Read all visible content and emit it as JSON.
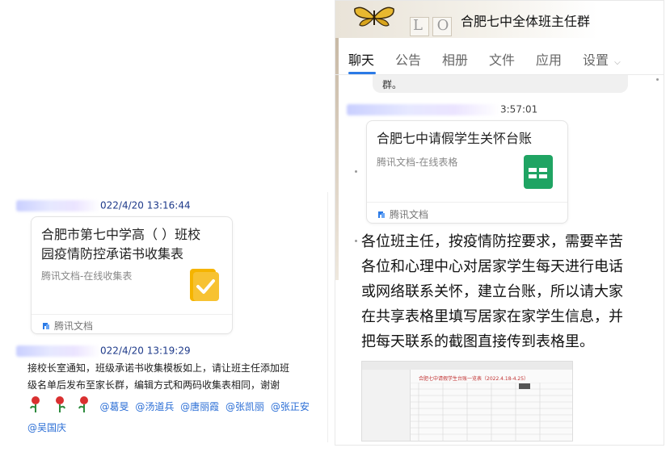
{
  "left": {
    "msg1_time": "022/4/20 13:16:44",
    "card1": {
      "title_line1": "合肥市第七中学高（  ）班校",
      "title_line2": "园疫情防控承诺书收集表",
      "subtitle": "腾讯文档-在线收集表",
      "footer": "腾讯文档"
    },
    "msg2_time": "022/4/20 13:19:29",
    "msg2_lines": [
      "接校长室通知，班级承诺书收集模板如上，请让班主任添加班",
      "级名单后发布至家长群，编辑方式和两码收集表相同，谢谢"
    ],
    "mentions_row1": [
      "@葛旻",
      "@汤道兵",
      "@唐丽霞",
      "@张凯丽",
      "@张正安"
    ],
    "mentions_row2": [
      "@吴国庆"
    ]
  },
  "right": {
    "group_title": "合肥七中全体班主任群",
    "header_letters": "L  O",
    "tabs": [
      "聊天",
      "公告",
      "相册",
      "文件",
      "应用",
      "设置"
    ],
    "prev_bubble_text": "群。",
    "msg_time": "3:57:01",
    "card": {
      "title": "合肥七中请假学生关怀台账",
      "subtitle": "腾讯文档-在线表格",
      "footer": "腾讯文档"
    },
    "message_lines": [
      "各位班主任，按疫情防控要求，需要辛苦",
      "各位和心理中心对居家学生每天进行电话",
      "或网络联系关怀，建立台账，所以请大家",
      "在共享表格里填写居家在家学生信息，并",
      "把每天联系的截图直接传到表格里。"
    ],
    "sheet_title": "合肥七中请假学生台账一览表（2022.4.18-4.25）"
  },
  "colors": {
    "accent_blue": "#2b7ae6",
    "timestamp_blue": "#1e3a8a",
    "mention_blue": "#2c6fd6",
    "form_icon_yellow": "#f5b400",
    "sheet_icon_green": "#1fa463"
  }
}
